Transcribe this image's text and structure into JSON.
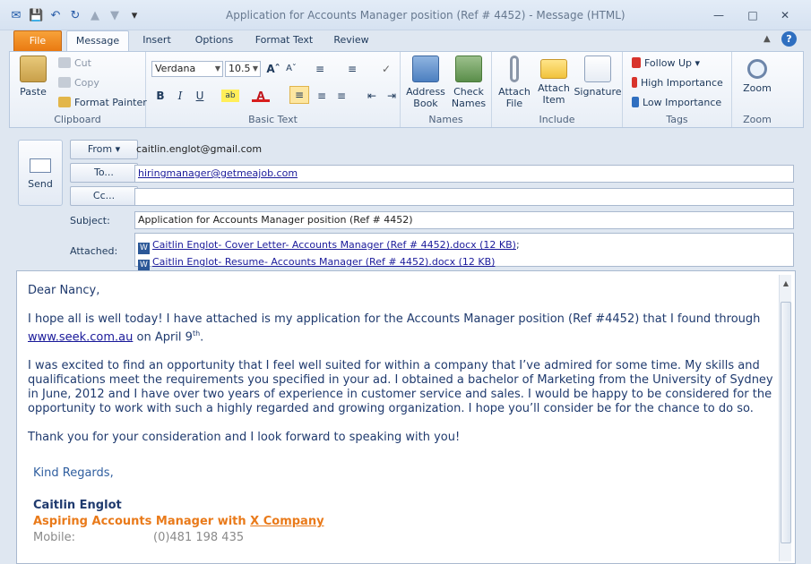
{
  "window": {
    "title": "Application for Accounts Manager position (Ref # 4452)  -  Message (HTML)",
    "minimize": "—",
    "maximize": "□",
    "close": "✕"
  },
  "tabs": [
    "File",
    "Message",
    "Insert",
    "Options",
    "Format Text",
    "Review"
  ],
  "ribbon": {
    "clipboard": {
      "label": "Clipboard",
      "paste": "Paste",
      "cut": "Cut",
      "copy": "Copy",
      "format_painter": "Format Painter"
    },
    "basic_text": {
      "label": "Basic Text",
      "font": "Verdana",
      "size": "10.5"
    },
    "names": {
      "label": "Names",
      "address_book": "Address\nBook",
      "check_names": "Check\nNames"
    },
    "include": {
      "label": "Include",
      "attach_file": "Attach\nFile",
      "attach_item": "Attach\nItem",
      "signature": "Signature"
    },
    "tags": {
      "label": "Tags",
      "follow_up": "Follow Up",
      "high": "High Importance",
      "low": "Low Importance"
    },
    "zoom": {
      "label": "Zoom",
      "zoom": "Zoom"
    }
  },
  "header": {
    "send": "Send",
    "from_btn": "From",
    "from_value": "caitlin.englot@gmail.com",
    "to_btn": "To...",
    "to_value": "hiringmanager@getmeajob.com",
    "cc_btn": "Cc...",
    "cc_value": "",
    "subject_label": "Subject:",
    "subject_value": "Application for Accounts Manager position (Ref # 4452)",
    "attached_label": "Attached:",
    "attachments": [
      "Caitlin Englot- Cover Letter- Accounts Manager (Ref # 4452).docx (12 KB)",
      "Caitlin Englot- Resume- Accounts Manager (Ref # 4452).docx (12 KB)"
    ]
  },
  "body": {
    "greeting": "Dear Nancy,",
    "p1_before": "I hope all is well today! I have attached is my application for the Accounts Manager position (Ref #4452) that I found through ",
    "p1_link": "www.seek.com.au",
    "p1_after": " on April 9",
    "p1_sup": "th",
    "p1_end": ".",
    "p2": "I was excited to find an opportunity that I feel well suited for within a company that I’ve admired for some time. My skills and qualifications meet the requirements you specified in your ad. I obtained a bachelor of Marketing from the University of Sydney in June, 2012 and I have over two years of experience in customer service and sales. I would be happy to be considered for the opportunity to work with such a highly regarded and growing organization. I hope you’ll consider be for the chance to do so.",
    "p3": "Thank you for your consideration and I look forward to speaking with you!",
    "regards": "Kind Regards,",
    "name": "Caitlin Englot",
    "title_before": "Aspiring Accounts Manager with ",
    "title_link": "X Company",
    "mobile_label": "Mobile:",
    "mobile_value": "(0)481 198 435"
  }
}
